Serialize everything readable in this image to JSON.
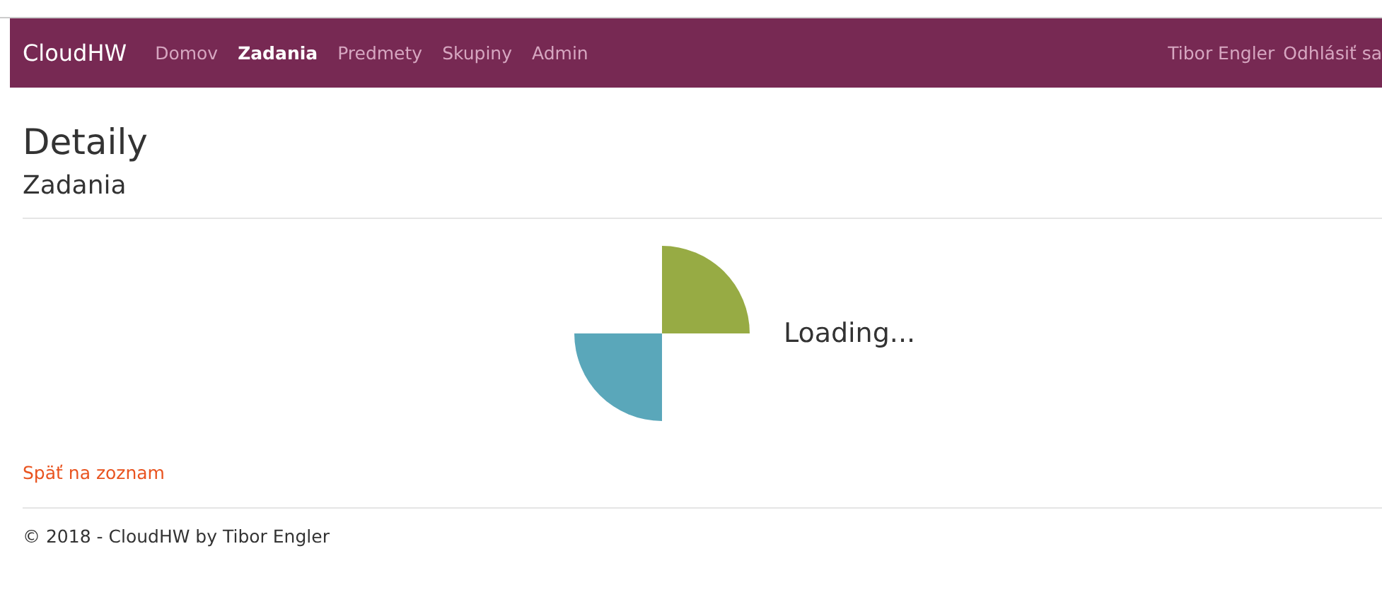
{
  "navbar": {
    "brand": "CloudHW",
    "items": [
      {
        "label": "Domov",
        "selected": false
      },
      {
        "label": "Zadania",
        "selected": true
      },
      {
        "label": "Predmety",
        "selected": false
      },
      {
        "label": "Skupiny",
        "selected": false
      },
      {
        "label": "Admin",
        "selected": false
      }
    ],
    "user": "Tibor Engler",
    "logout": "Odhlásiť sa"
  },
  "page": {
    "title": "Detaily",
    "subtitle": "Zadania"
  },
  "loader": {
    "text": "Loading..."
  },
  "back_link": "Späť na zoznam",
  "footer": "© 2018 - CloudHW by Tibor Engler"
}
